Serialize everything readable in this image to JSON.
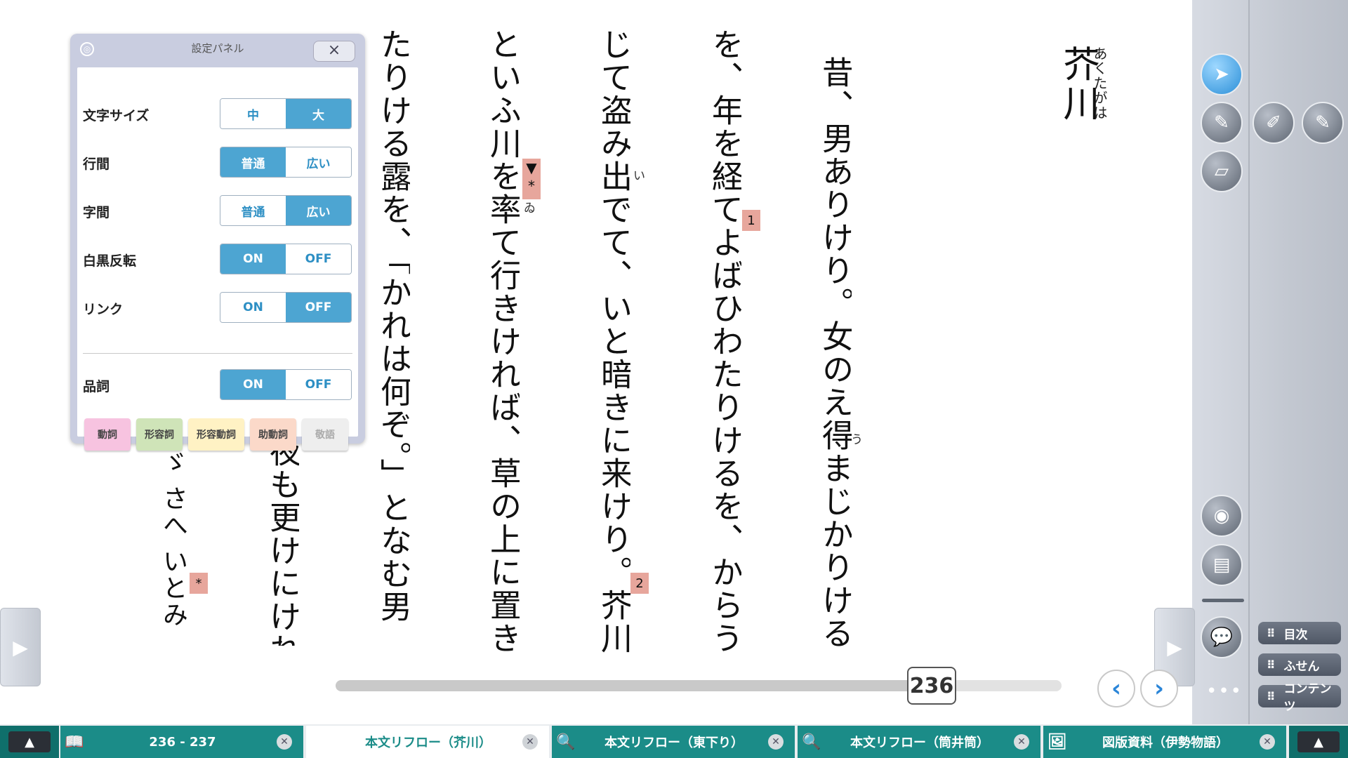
{
  "reader": {
    "title": "芥川",
    "title_ruby": "あくたがは",
    "columns": [
      "昔、男ありけり。女のえ得まじかりける",
      "を、年を経てよばひわたりけるを、からう",
      "じて盗み出でて、いと暗きに来けり。芥川",
      "といふ川を率て行きければ、草の上に置き",
      "たりける露を、「かれは何ぞ。」となむ男",
      "夜も更けにけれ",
      "ゞ さへ いとみ"
    ],
    "ruby": {
      "u": "う",
      "i": "い",
      "wi": "ゐ"
    },
    "notes": {
      "n1": "1",
      "n2": "2",
      "star": "*",
      "marker": "▼\n*"
    }
  },
  "settings": {
    "title": "設定パネル",
    "close_icon": "×",
    "rows": [
      {
        "label": "文字サイズ",
        "a": "中",
        "b": "大",
        "selected": "b"
      },
      {
        "label": "行間",
        "a": "普通",
        "b": "広い",
        "selected": "a"
      },
      {
        "label": "字間",
        "a": "普通",
        "b": "広い",
        "selected": "b"
      },
      {
        "label": "白黒反転",
        "a": "ON",
        "b": "OFF",
        "selected": "a"
      },
      {
        "label": "リンク",
        "a": "ON",
        "b": "OFF",
        "selected": "b"
      },
      {
        "label": "品詞",
        "a": "ON",
        "b": "OFF",
        "selected": "a"
      }
    ],
    "parts_of_speech": [
      {
        "label": "動詞",
        "color": "#f7c3e0"
      },
      {
        "label": "形容詞",
        "color": "#cfe4b8"
      },
      {
        "label": "形容動詞",
        "color": "#fff2c4"
      },
      {
        "label": "助動詞",
        "color": "#fbd9c9"
      },
      {
        "label": "敬語",
        "color": "#eeeeee"
      }
    ]
  },
  "toolbar": {
    "nav": {
      "toc": "目次",
      "sticky": "ふせん",
      "contents": "コンテンツ"
    },
    "icons": [
      "pointer-icon",
      "pen-icon",
      "highlighter-icon",
      "marker-icon",
      "eraser-icon",
      "camera-icon",
      "notebook-icon",
      "comment-icon",
      "more-icon"
    ]
  },
  "pager": {
    "page": "236",
    "progress": 0.85,
    "prev": "‹",
    "next": "›"
  },
  "tabs": [
    {
      "label": "236 - 237",
      "icon": "book-icon"
    },
    {
      "label": "本文リフロー（芥川）",
      "icon": "",
      "active": true
    },
    {
      "label": "本文リフロー（東下り）",
      "icon": "book-search-icon"
    },
    {
      "label": "本文リフロー（筒井筒）",
      "icon": "book-search-icon"
    },
    {
      "label": "図版資料（伊勢物語）",
      "icon": "image-search-icon"
    }
  ],
  "colors": {
    "accent": "#4da5d2",
    "tab": "#1b8c88",
    "note": "#e7a69c"
  }
}
